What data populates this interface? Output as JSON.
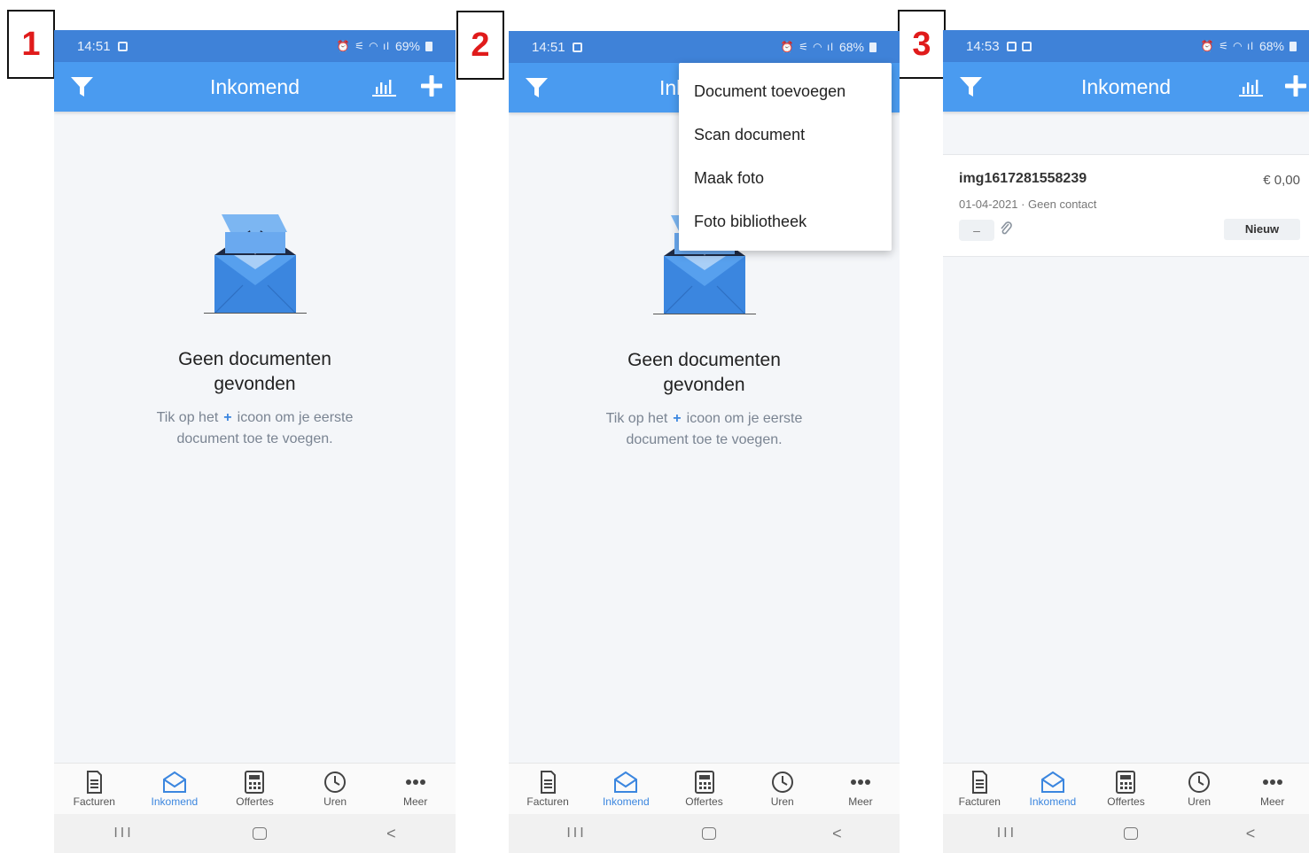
{
  "steps": [
    "1",
    "2",
    "3"
  ],
  "screens": [
    {
      "status": {
        "time": "14:51",
        "battery": "69%"
      },
      "title": "Inkomend",
      "empty": {
        "heading_line1": "Geen documenten",
        "heading_line2": "gevonden",
        "hint_before": "Tik op het",
        "hint_plus": "+",
        "hint_after": "icoon om je eerste",
        "hint_line2": "document toe te voegen."
      }
    },
    {
      "status": {
        "time": "14:51",
        "battery": "68%"
      },
      "title": "Inkomend",
      "empty": {
        "heading_line1": "Geen documenten",
        "heading_line2": "gevonden",
        "hint_before": "Tik op het",
        "hint_plus": "+",
        "hint_after": "icoon om je eerste",
        "hint_line2": "document toe te voegen."
      },
      "menu": [
        "Document toevoegen",
        "Scan document",
        "Maak foto",
        "Foto bibliotheek"
      ]
    },
    {
      "status": {
        "time": "14:53",
        "battery": "68%"
      },
      "title": "Inkomend",
      "document": {
        "name": "img1617281558239",
        "amount": "€ 0,00",
        "meta": "01-04-2021 · Geen contact",
        "chip": "–",
        "status": "Nieuw"
      }
    }
  ],
  "tabs": [
    "Facturen",
    "Inkomend",
    "Offertes",
    "Uren",
    "Meer"
  ],
  "active_tab": "Inkomend",
  "nav": {
    "recents": "III",
    "back": "<"
  },
  "colors": {
    "statusbar": "#3f82d8",
    "appbar": "#4a9bf0",
    "accent": "#3b86df",
    "step_number": "#e01b1b"
  },
  "icons": [
    "filter-icon",
    "chart-icon",
    "plus-icon",
    "envelope-icon",
    "invoice-icon",
    "inbox-icon",
    "calculator-icon",
    "clock-icon",
    "more-icon",
    "paperclip-icon"
  ]
}
